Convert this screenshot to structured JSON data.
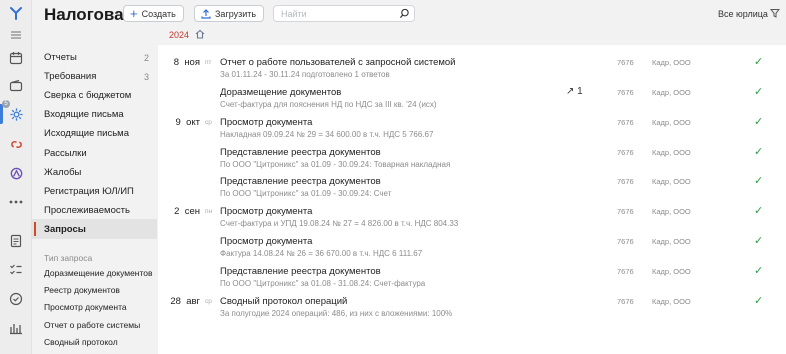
{
  "header": {
    "title": "Налоговая",
    "create_label": "Создать",
    "upload_label": "Загрузить",
    "search_placeholder": "Найти",
    "all_legal_label": "Все юрлица",
    "year": "2024"
  },
  "rail": {
    "badge": "5",
    "icons": [
      "logo-icon",
      "menu-icon",
      "calendar-icon",
      "wallet-icon",
      "settings-icon",
      "integration-icon",
      "nodes-icon",
      "more-icon",
      "document-icon",
      "tasks-icon",
      "check-shield-icon",
      "chart-icon"
    ]
  },
  "sidebar": {
    "items": [
      {
        "label": "Отчеты",
        "count": "2"
      },
      {
        "label": "Требования",
        "count": "3"
      },
      {
        "label": "Сверка с бюджетом",
        "count": ""
      },
      {
        "label": "Входящие письма",
        "count": ""
      },
      {
        "label": "Исходящие письма",
        "count": ""
      },
      {
        "label": "Рассылки",
        "count": ""
      },
      {
        "label": "Жалобы",
        "count": ""
      },
      {
        "label": "Регистрация ЮЛ/ИП",
        "count": ""
      },
      {
        "label": "Прослеживаемость",
        "count": ""
      },
      {
        "label": "Запросы",
        "count": ""
      }
    ],
    "sub_heading": "Тип запроса",
    "sub_items": [
      "Доразмещение документов",
      "Реестр документов",
      "Просмотр документа",
      "Отчет о работе системы",
      "Сводный протокол"
    ]
  },
  "requests": [
    {
      "day": "8",
      "month": "ноя",
      "weekday": "пт",
      "title": "Отчет о работе пользователей с запросной системой",
      "subtitle": "За 01.11.24 - 30.11.24 подготовлено 1 ответов",
      "code": "7676",
      "org": "Кадр, ООО",
      "fwd_count": ""
    },
    {
      "day": "",
      "month": "",
      "weekday": "",
      "title": "Доразмещение документов",
      "subtitle": "Счет-фактура для пояснения НД по НДС за III кв. '24 (исх)",
      "code": "7676",
      "org": "Кадр, ООО",
      "fwd_count": "1"
    },
    {
      "day": "9",
      "month": "окт",
      "weekday": "ср",
      "title": "Просмотр документа",
      "subtitle": "Накладная 09.09.24 № 29 = 34 600.00 в т.ч. НДС 5 766.67",
      "code": "7676",
      "org": "Кадр, ООО",
      "fwd_count": ""
    },
    {
      "day": "",
      "month": "",
      "weekday": "",
      "title": "Представление реестра документов",
      "subtitle": "По ООО \"Цитроникс\" за 01.09 - 30.09.24: Товарная накладная",
      "code": "7676",
      "org": "Кадр, ООО",
      "fwd_count": ""
    },
    {
      "day": "",
      "month": "",
      "weekday": "",
      "title": "Представление реестра документов",
      "subtitle": "По ООО \"Цитроникс\" за 01.09 - 30.09.24: Счет",
      "code": "7676",
      "org": "Кадр, ООО",
      "fwd_count": ""
    },
    {
      "day": "2",
      "month": "сен",
      "weekday": "пн",
      "title": "Просмотр документа",
      "subtitle": "Счет-фактура и УПД 19.08.24 № 27 = 4 826.00 в т.ч. НДС 804.33",
      "code": "7676",
      "org": "Кадр, ООО",
      "fwd_count": ""
    },
    {
      "day": "",
      "month": "",
      "weekday": "",
      "title": "Просмотр документа",
      "subtitle": "Фактура 14.08.24 № 26 = 36 670.00 в т.ч. НДС 6 111.67",
      "code": "7676",
      "org": "Кадр, ООО",
      "fwd_count": ""
    },
    {
      "day": "",
      "month": "",
      "weekday": "",
      "title": "Представление реестра документов",
      "subtitle": "По ООО \"Цитроникс\" за 01.08 - 31.08.24: Счет-фактура",
      "code": "7676",
      "org": "Кадр, ООО",
      "fwd_count": ""
    },
    {
      "day": "28",
      "month": "авг",
      "weekday": "ср",
      "title": "Сводный протокол операций",
      "subtitle": "За полугодие 2024 операций: 486, из них с вложениями: 100%",
      "code": "7676",
      "org": "Кадр, ООО",
      "fwd_count": ""
    }
  ],
  "colors": {
    "accent": "#2f6fd6",
    "selected_marker": "#d04a2a",
    "check": "#2e9b46",
    "year": "#c0392b"
  }
}
